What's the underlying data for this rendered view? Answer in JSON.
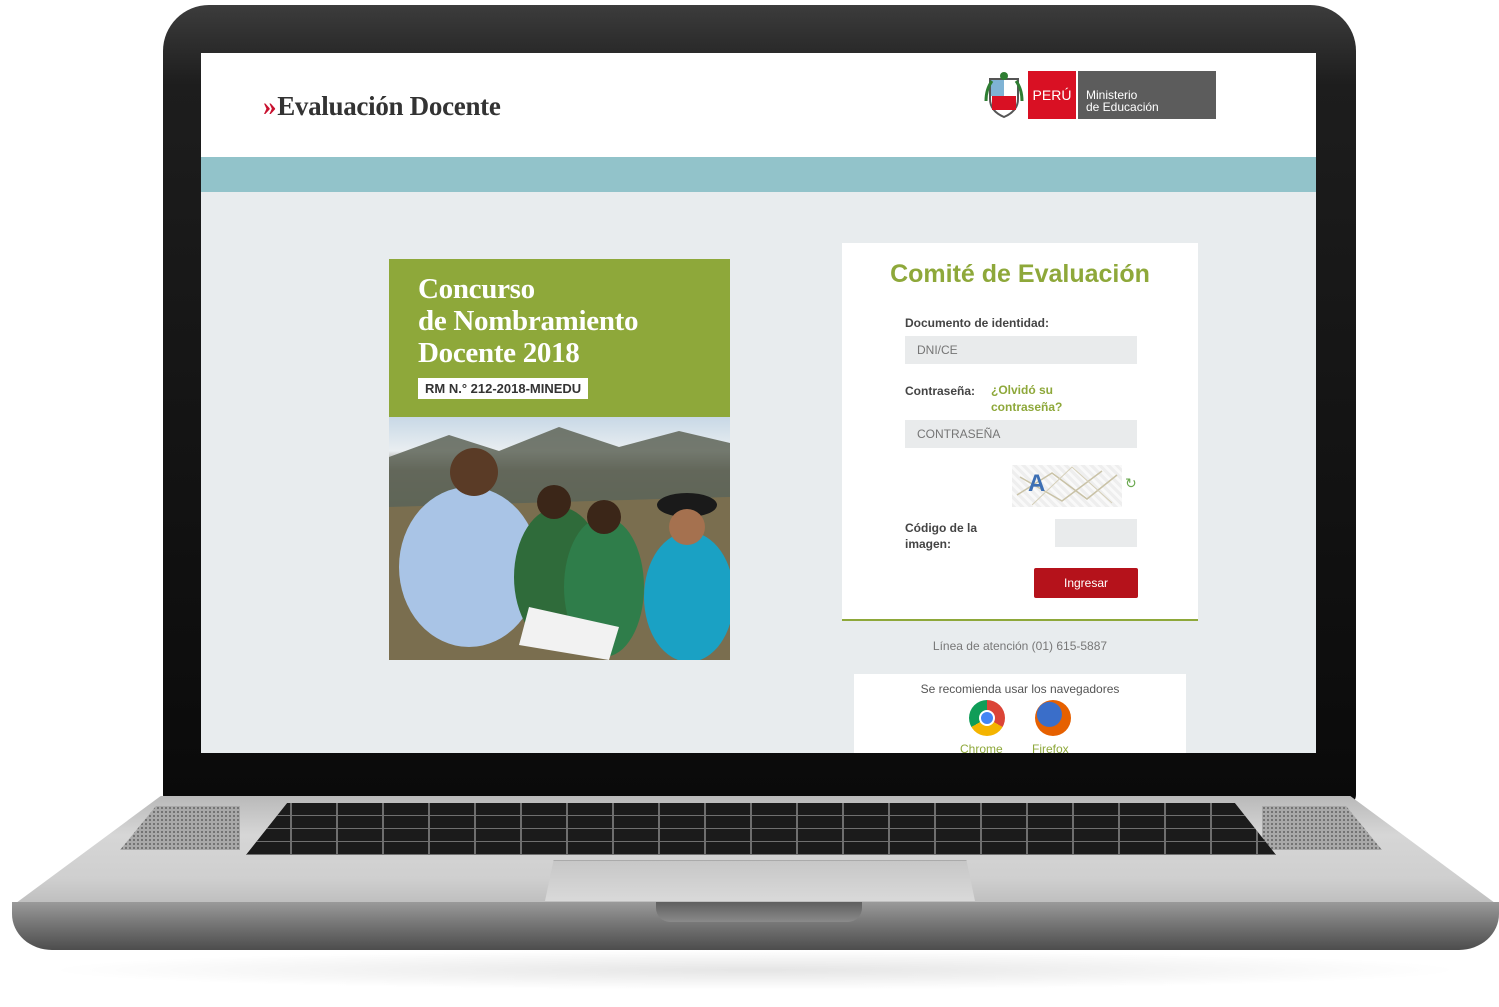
{
  "header": {
    "brand_chevron": "»",
    "brand_title": "Evaluación Docente",
    "gov_country": "PERÚ",
    "gov_ministry_line1": "Ministerio",
    "gov_ministry_line2": "de Educación"
  },
  "banner": {
    "title_line1": "Concurso",
    "title_line2": "de Nombramiento",
    "title_line3": "Docente 2018",
    "resolution": "RM N.° 212-2018-MINEDU"
  },
  "login": {
    "title": "Comité de Evaluación",
    "document_label": "Documento de identidad:",
    "document_placeholder": "DNI/CE",
    "password_label": "Contraseña:",
    "forgot_link": "¿Olvidó su contraseña?",
    "password_placeholder": "CONTRASEÑA",
    "captcha_text": "A",
    "captcha_label": "Código de la imagen:",
    "submit_label": "Ingresar"
  },
  "support": {
    "phone_line": "Línea de atención (01) 615-5887"
  },
  "browsers": {
    "title": "Se recomienda usar los navegadores",
    "items": [
      "Chrome",
      "Firefox"
    ]
  },
  "colors": {
    "brand_red": "#c8102e",
    "accent_green": "#8ea83a",
    "band_teal": "#92c3ca",
    "button_red": "#b5121b"
  }
}
